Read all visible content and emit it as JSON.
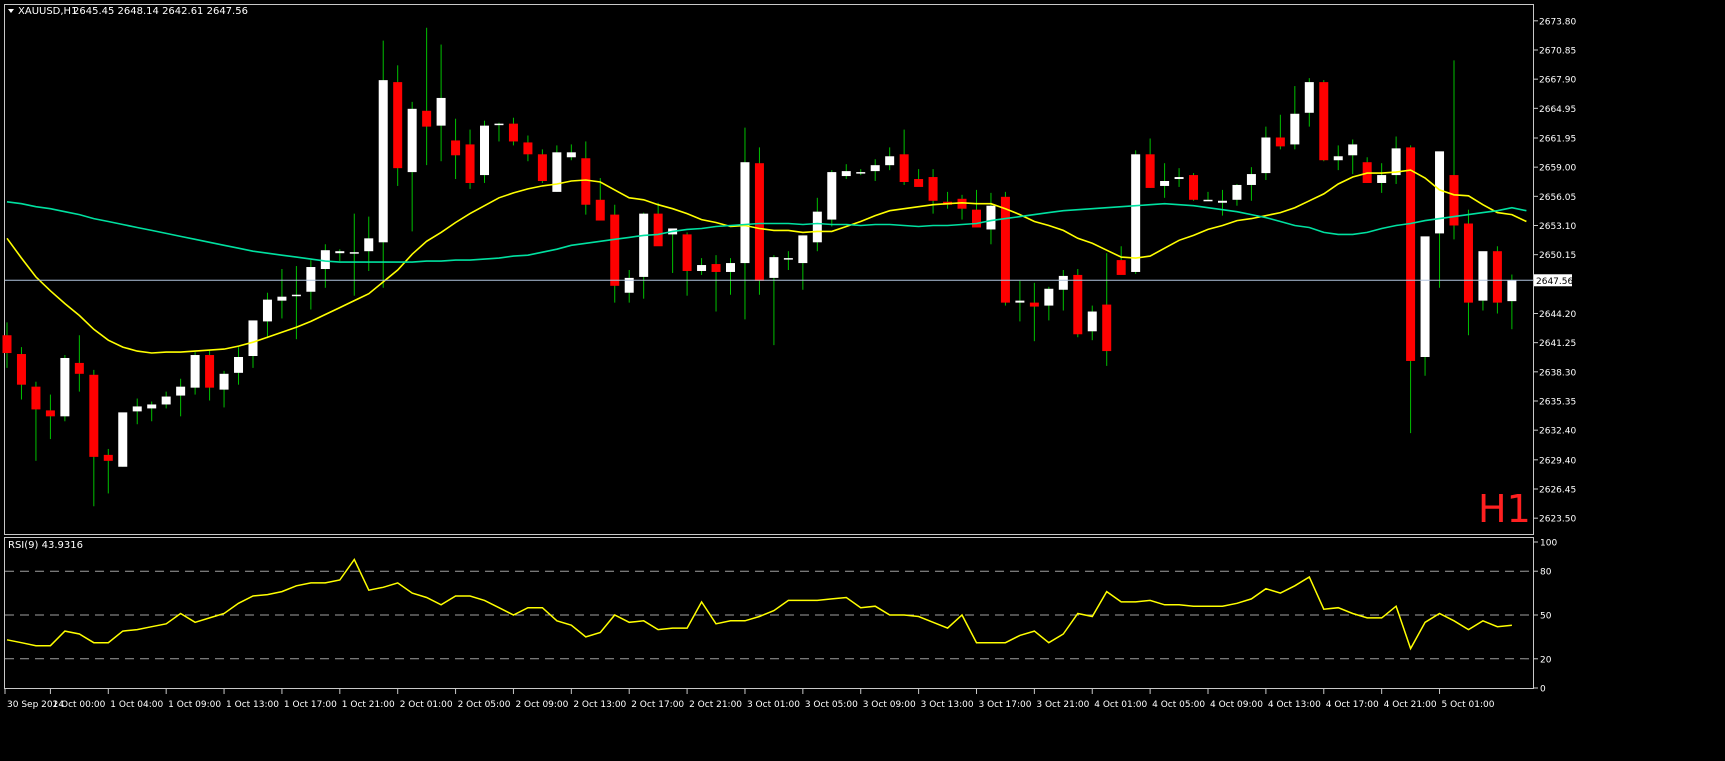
{
  "symbol_line": {
    "symbol": "XAUUSD,H1",
    "ohlc": "2645.45 2648.14 2642.61 2647.56"
  },
  "timeframe_watermark": "H1",
  "rsi_label": "RSI(9) 43.9316",
  "current_price": "2647.56",
  "colors": {
    "background": "#000000",
    "frame": "#c8c8c8",
    "bull_candle": "#ffffff",
    "bear_candle": "#ff0000",
    "wick": "#00c000",
    "ma_fast": "#ffff00",
    "ma_slow": "#00e0a0",
    "rsi_line": "#ffff00",
    "watermark": "#ff2020"
  },
  "chart_data": [
    {
      "type": "candlestick",
      "ylim": [
        2622.0,
        2675.4
      ],
      "price_ticks": [
        "2673.80",
        "2670.85",
        "2667.90",
        "2664.95",
        "2661.95",
        "2659.00",
        "2656.05",
        "2653.10",
        "2650.15",
        "2647.56",
        "2644.20",
        "2641.25",
        "2638.30",
        "2635.35",
        "2632.40",
        "2629.40",
        "2626.45",
        "2623.50"
      ],
      "time_labels": [
        "30 Sep 2024",
        "1 Oct 00:00",
        "1 Oct 04:00",
        "1 Oct 09:00",
        "1 Oct 13:00",
        "1 Oct 17:00",
        "1 Oct 21:00",
        "2 Oct 01:00",
        "2 Oct 05:00",
        "2 Oct 09:00",
        "2 Oct 13:00",
        "2 Oct 17:00",
        "2 Oct 21:00",
        "3 Oct 01:00",
        "3 Oct 05:00",
        "3 Oct 09:00",
        "3 Oct 13:00",
        "3 Oct 17:00",
        "3 Oct 21:00",
        "4 Oct 01:00",
        "4 Oct 05:00",
        "4 Oct 09:00",
        "4 Oct 13:00",
        "4 Oct 17:00",
        "4 Oct 21:00",
        "5 Oct 01:00"
      ],
      "ohlc": [
        [
          2642.0,
          2643.3,
          2638.7,
          2640.2
        ],
        [
          2640.1,
          2640.8,
          2635.5,
          2637.0
        ],
        [
          2636.8,
          2637.3,
          2629.3,
          2634.5
        ],
        [
          2634.4,
          2636.0,
          2631.5,
          2633.8
        ],
        [
          2633.8,
          2640.0,
          2633.3,
          2639.7
        ],
        [
          2639.2,
          2642.0,
          2636.3,
          2638.1
        ],
        [
          2638.0,
          2638.5,
          2624.7,
          2629.7
        ],
        [
          2629.9,
          2630.5,
          2626.0,
          2629.3
        ],
        [
          2628.7,
          2634.0,
          2628.7,
          2634.2
        ],
        [
          2634.3,
          2635.6,
          2633.0,
          2634.8
        ],
        [
          2634.6,
          2635.3,
          2633.3,
          2635.0
        ],
        [
          2635.0,
          2636.3,
          2634.6,
          2635.8
        ],
        [
          2635.9,
          2637.6,
          2633.8,
          2636.8
        ],
        [
          2636.7,
          2640.3,
          2636.0,
          2640.0
        ],
        [
          2640.0,
          2640.5,
          2635.4,
          2636.7
        ],
        [
          2636.5,
          2638.4,
          2634.7,
          2638.1
        ],
        [
          2638.2,
          2640.8,
          2637.0,
          2639.8
        ],
        [
          2639.9,
          2643.2,
          2638.7,
          2643.5
        ],
        [
          2643.4,
          2646.3,
          2641.7,
          2645.6
        ],
        [
          2645.5,
          2648.7,
          2643.7,
          2645.9
        ],
        [
          2646.0,
          2649.0,
          2641.6,
          2646.1
        ],
        [
          2646.4,
          2649.6,
          2644.6,
          2648.9
        ],
        [
          2648.7,
          2651.2,
          2646.8,
          2650.6
        ],
        [
          2650.3,
          2650.7,
          2649.5,
          2650.5
        ],
        [
          2650.3,
          2654.3,
          2646.0,
          2650.4
        ],
        [
          2650.5,
          2654.0,
          2648.5,
          2651.8
        ],
        [
          2651.4,
          2671.8,
          2646.8,
          2667.8
        ],
        [
          2667.6,
          2669.3,
          2657.1,
          2658.9
        ],
        [
          2658.5,
          2665.6,
          2652.5,
          2664.9
        ],
        [
          2664.7,
          2673.1,
          2659.2,
          2663.1
        ],
        [
          2663.2,
          2671.4,
          2659.6,
          2666.0
        ],
        [
          2661.7,
          2663.9,
          2657.8,
          2660.2
        ],
        [
          2661.3,
          2662.8,
          2656.8,
          2657.4
        ],
        [
          2658.2,
          2663.7,
          2657.4,
          2663.2
        ],
        [
          2663.4,
          2663.5,
          2661.6,
          2663.4
        ],
        [
          2663.4,
          2664.0,
          2661.2,
          2661.6
        ],
        [
          2661.5,
          2662.2,
          2659.6,
          2660.3
        ],
        [
          2660.3,
          2660.8,
          2657.4,
          2657.6
        ],
        [
          2656.5,
          2661.2,
          2656.5,
          2660.5
        ],
        [
          2660.0,
          2661.3,
          2659.7,
          2660.5
        ],
        [
          2659.9,
          2661.6,
          2654.2,
          2655.2
        ],
        [
          2655.7,
          2657.9,
          2654.5,
          2653.6
        ],
        [
          2654.2,
          2655.2,
          2645.3,
          2647.0
        ],
        [
          2646.3,
          2648.6,
          2645.3,
          2647.8
        ],
        [
          2647.9,
          2654.4,
          2645.7,
          2654.3
        ],
        [
          2654.3,
          2655.4,
          2651.6,
          2651.0
        ],
        [
          2652.2,
          2652.7,
          2648.3,
          2652.8
        ],
        [
          2652.2,
          2652.4,
          2646.0,
          2648.5
        ],
        [
          2648.5,
          2649.8,
          2648.1,
          2649.1
        ],
        [
          2649.2,
          2650.1,
          2644.4,
          2648.4
        ],
        [
          2648.4,
          2649.8,
          2646.1,
          2649.3
        ],
        [
          2649.3,
          2663.0,
          2643.6,
          2659.5
        ],
        [
          2659.4,
          2661.0,
          2646.1,
          2647.5
        ],
        [
          2647.8,
          2650.1,
          2641.0,
          2649.9
        ],
        [
          2649.8,
          2650.5,
          2648.6,
          2649.8
        ],
        [
          2649.3,
          2652.1,
          2646.6,
          2652.1
        ],
        [
          2651.4,
          2655.9,
          2650.5,
          2654.5
        ],
        [
          2653.7,
          2658.7,
          2653.0,
          2658.5
        ],
        [
          2658.1,
          2659.3,
          2657.8,
          2658.6
        ],
        [
          2658.4,
          2658.8,
          2658.2,
          2658.5
        ],
        [
          2658.6,
          2659.8,
          2657.6,
          2659.2
        ],
        [
          2659.2,
          2661.0,
          2658.7,
          2660.1
        ],
        [
          2660.3,
          2662.8,
          2657.2,
          2657.5
        ],
        [
          2657.8,
          2658.8,
          2657.5,
          2657.0
        ],
        [
          2658.0,
          2658.8,
          2654.3,
          2655.6
        ],
        [
          2655.5,
          2656.5,
          2654.8,
          2655.2
        ],
        [
          2655.8,
          2656.2,
          2653.7,
          2654.8
        ],
        [
          2654.7,
          2656.7,
          2654.0,
          2652.9
        ],
        [
          2652.7,
          2656.4,
          2651.2,
          2655.1
        ],
        [
          2656.0,
          2656.5,
          2645.0,
          2645.3
        ],
        [
          2645.3,
          2647.5,
          2643.4,
          2645.5
        ],
        [
          2645.3,
          2647.3,
          2641.4,
          2644.9
        ],
        [
          2645.0,
          2646.9,
          2643.5,
          2646.7
        ],
        [
          2646.6,
          2648.6,
          2644.5,
          2648.0
        ],
        [
          2648.1,
          2648.7,
          2641.8,
          2642.1
        ],
        [
          2642.4,
          2645.0,
          2641.5,
          2644.4
        ],
        [
          2645.1,
          2650.3,
          2638.9,
          2640.4
        ],
        [
          2649.6,
          2651.0,
          2648.7,
          2648.1
        ],
        [
          2648.4,
          2660.7,
          2648.2,
          2660.3
        ],
        [
          2660.3,
          2661.9,
          2656.9,
          2656.9
        ],
        [
          2657.1,
          2659.4,
          2655.9,
          2657.6
        ],
        [
          2657.8,
          2658.9,
          2657.0,
          2658.0
        ],
        [
          2658.2,
          2658.4,
          2655.6,
          2655.7
        ],
        [
          2655.7,
          2656.5,
          2655.6,
          2655.7
        ],
        [
          2655.4,
          2656.7,
          2654.1,
          2655.6
        ],
        [
          2655.7,
          2657.3,
          2655.1,
          2657.2
        ],
        [
          2657.2,
          2659.0,
          2655.6,
          2658.3
        ],
        [
          2658.4,
          2663.1,
          2657.7,
          2662.0
        ],
        [
          2662.0,
          2664.3,
          2660.8,
          2661.1
        ],
        [
          2661.3,
          2667.2,
          2660.8,
          2664.4
        ],
        [
          2664.5,
          2668.0,
          2663.1,
          2667.6
        ],
        [
          2667.6,
          2667.8,
          2659.6,
          2659.7
        ],
        [
          2659.7,
          2661.2,
          2658.7,
          2660.1
        ],
        [
          2660.2,
          2661.8,
          2658.3,
          2661.3
        ],
        [
          2659.5,
          2660.0,
          2657.7,
          2657.4
        ],
        [
          2657.4,
          2659.4,
          2656.4,
          2658.2
        ],
        [
          2658.2,
          2662.1,
          2657.3,
          2660.9
        ],
        [
          2661.0,
          2661.2,
          2632.1,
          2639.4
        ],
        [
          2639.8,
          2651.3,
          2637.9,
          2652.0
        ],
        [
          2652.3,
          2660.3,
          2646.8,
          2660.6
        ],
        [
          2658.2,
          2669.8,
          2651.7,
          2653.1
        ],
        [
          2653.3,
          2654.7,
          2642.0,
          2645.3
        ],
        [
          2645.5,
          2650.3,
          2644.5,
          2650.5
        ],
        [
          2650.5,
          2651.0,
          2644.2,
          2645.3
        ],
        [
          2645.45,
          2648.14,
          2642.61,
          2647.56
        ]
      ],
      "series": [
        {
          "values": [
            2651.8,
            2649.8,
            2647.9,
            2646.5,
            2645.2,
            2644.0,
            2642.6,
            2641.5,
            2640.8,
            2640.4,
            2640.2,
            2640.3,
            2640.3,
            2640.4,
            2640.5,
            2640.6,
            2640.9,
            2641.3,
            2641.8,
            2642.3,
            2642.8,
            2643.4,
            2644.1,
            2644.8,
            2645.5,
            2646.2,
            2647.4,
            2648.6,
            2650.2,
            2651.5,
            2652.4,
            2653.4,
            2654.3,
            2655.1,
            2655.9,
            2656.4,
            2656.8,
            2657.1,
            2657.3,
            2657.6,
            2657.7,
            2657.5,
            2656.7,
            2655.9,
            2655.7,
            2655.2,
            2654.8,
            2654.3,
            2653.7,
            2653.4,
            2653.0,
            2653.1,
            2652.8,
            2652.6,
            2652.6,
            2652.4,
            2652.5,
            2652.5,
            2653.0,
            2653.5,
            2654.1,
            2654.6,
            2654.8,
            2655.0,
            2655.2,
            2655.3,
            2655.4,
            2655.3,
            2655.3,
            2654.8,
            2654.2,
            2653.5,
            2653.1,
            2652.6,
            2651.8,
            2651.3,
            2650.6,
            2649.9,
            2649.8,
            2650.0,
            2650.8,
            2651.6,
            2652.1,
            2652.7,
            2653.1,
            2653.6,
            2653.8,
            2654.1,
            2654.4,
            2654.9,
            2655.6,
            2656.3,
            2657.3,
            2658.0,
            2658.4,
            2658.4,
            2658.5,
            2658.7,
            2657.9,
            2656.7,
            2656.2,
            2656.1,
            2655.2,
            2654.4,
            2654.2,
            2653.5
          ],
          "color": "#ffff00"
        },
        {
          "values": [
            2655.5,
            2655.3,
            2655.0,
            2654.8,
            2654.5,
            2654.2,
            2653.8,
            2653.5,
            2653.2,
            2652.9,
            2652.6,
            2652.3,
            2652.0,
            2651.7,
            2651.4,
            2651.1,
            2650.8,
            2650.5,
            2650.3,
            2650.1,
            2649.9,
            2649.7,
            2649.5,
            2649.4,
            2649.4,
            2649.4,
            2649.4,
            2649.4,
            2649.4,
            2649.5,
            2649.5,
            2649.6,
            2649.6,
            2649.7,
            2649.8,
            2650.0,
            2650.1,
            2650.4,
            2650.7,
            2651.1,
            2651.3,
            2651.5,
            2651.7,
            2651.9,
            2652.1,
            2652.2,
            2652.5,
            2652.7,
            2652.8,
            2653.0,
            2653.1,
            2653.2,
            2653.3,
            2653.3,
            2653.3,
            2653.2,
            2653.3,
            2653.2,
            2653.2,
            2653.1,
            2653.2,
            2653.2,
            2653.1,
            2653.0,
            2653.1,
            2653.1,
            2653.2,
            2653.3,
            2653.6,
            2653.8,
            2654.0,
            2654.2,
            2654.4,
            2654.6,
            2654.7,
            2654.8,
            2654.9,
            2655.0,
            2655.1,
            2655.2,
            2655.3,
            2655.2,
            2655.1,
            2654.9,
            2654.7,
            2654.5,
            2654.2,
            2653.9,
            2653.5,
            2653.1,
            2652.9,
            2652.4,
            2652.2,
            2652.2,
            2652.4,
            2652.8,
            2653.1,
            2653.3,
            2653.6,
            2653.8,
            2654.0,
            2654.2,
            2654.4,
            2654.6,
            2654.9,
            2654.6
          ],
          "color": "#00e0a0"
        }
      ]
    },
    {
      "type": "line",
      "title": "RSI(9) 43.9316",
      "ylim": [
        0,
        100
      ],
      "yticks": [
        "100",
        "80",
        "50",
        "20",
        "0"
      ],
      "levels": [
        80,
        50,
        20
      ],
      "series": [
        {
          "values": [
            33,
            31,
            29,
            29,
            39,
            37,
            31,
            31,
            39,
            40,
            42,
            44,
            51,
            45,
            48,
            51,
            58,
            63,
            64,
            66,
            70,
            72,
            72,
            74,
            88,
            67,
            69,
            72,
            65,
            62,
            57,
            63,
            63,
            60,
            55,
            50,
            55,
            55,
            46,
            43,
            35,
            38,
            50,
            45,
            46,
            40,
            41,
            41,
            59,
            44,
            46,
            46,
            49,
            53,
            60,
            60,
            60,
            61,
            62,
            55,
            56,
            50,
            50,
            49,
            45,
            41,
            50,
            31,
            31,
            31,
            36,
            39,
            31,
            37,
            51,
            49,
            66,
            59,
            59,
            60,
            57,
            57,
            56,
            56,
            56,
            58,
            61,
            68,
            65,
            70,
            76,
            54,
            55,
            51,
            48,
            48,
            56,
            27,
            45,
            51,
            46,
            40,
            46,
            42,
            43
          ],
          "color": "#ffff00"
        }
      ]
    }
  ]
}
